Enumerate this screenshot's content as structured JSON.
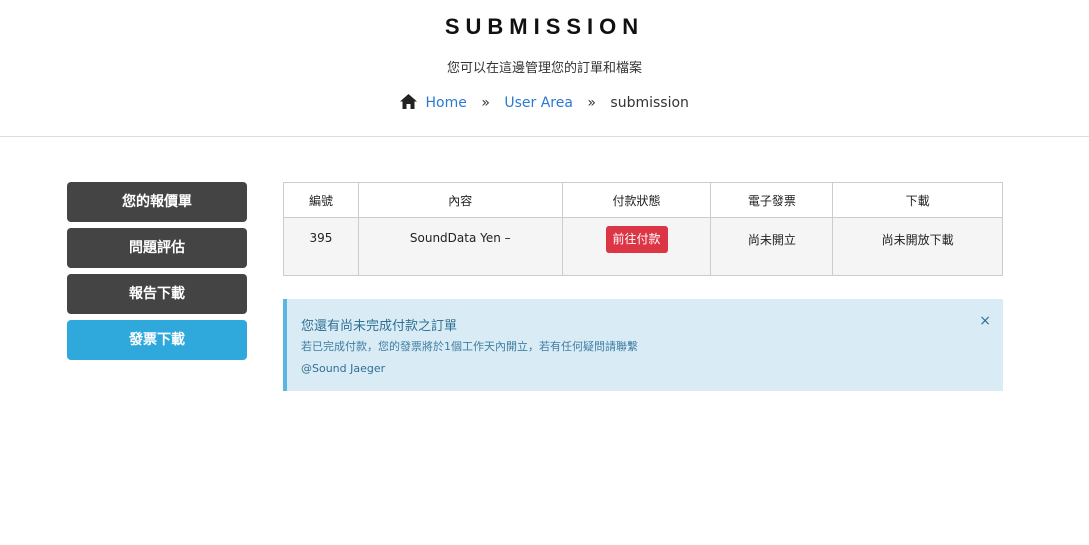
{
  "header": {
    "title": "SUBMISSION",
    "subtitle": "您可以在這邊管理您的訂單和檔案",
    "breadcrumb": {
      "home": "Home",
      "user_area": "User Area",
      "current": "submission",
      "separator": "»"
    }
  },
  "sidebar": {
    "items": [
      {
        "label": "您的報價單",
        "active": false
      },
      {
        "label": "問題評估",
        "active": false
      },
      {
        "label": "報告下載",
        "active": false
      },
      {
        "label": "發票下載",
        "active": true
      }
    ]
  },
  "table": {
    "headers": [
      "編號",
      "內容",
      "付款狀態",
      "電子發票",
      "下載"
    ],
    "rows": [
      {
        "id": "395",
        "content": "SoundData Yen –",
        "payment_button": "前往付款",
        "invoice": "尚未開立",
        "download": "尚未開放下載"
      }
    ]
  },
  "alert": {
    "title": "您還有尚未完成付款之訂單",
    "body": "若已完成付款，您的發票將於1個工作天內開立，若有任何疑問請聯繫",
    "signature": "@Sound Jaeger",
    "close": "×"
  },
  "colors": {
    "sidebar_bg": "#444444",
    "sidebar_active": "#2fa8dc",
    "pay_button": "#dc3545",
    "link": "#2a7ad3",
    "alert_bg": "#d9ecf5"
  },
  "icons": {
    "home": "home-icon",
    "close": "close-icon"
  }
}
